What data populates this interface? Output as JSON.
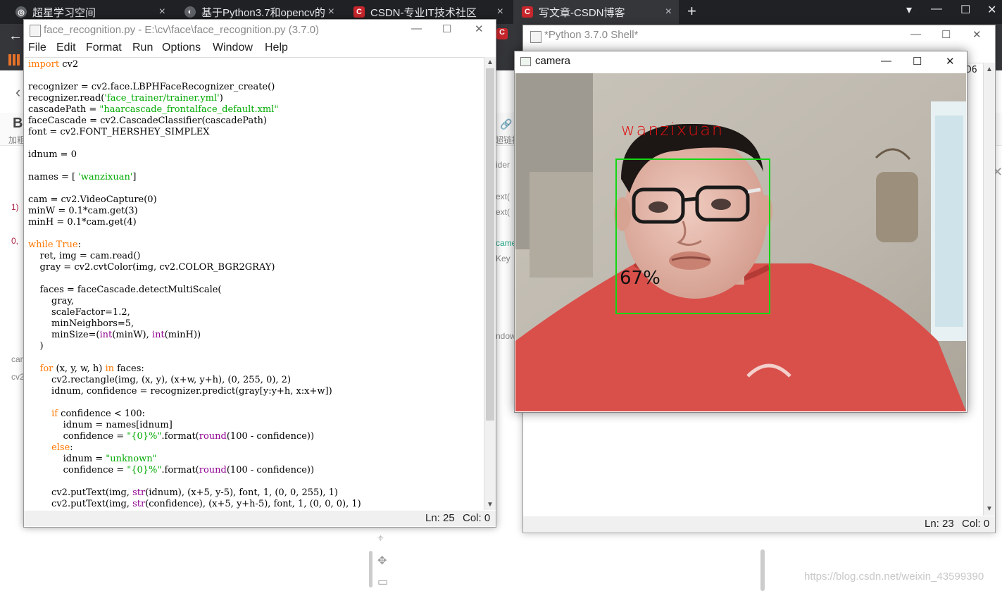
{
  "browser": {
    "tabs": [
      {
        "label": "超星学习空间",
        "icon": "globe-icon"
      },
      {
        "label": "基于Python3.7和opencv的",
        "icon": "github-icon"
      },
      {
        "label": "CSDN-专业IT技术社区",
        "icon": "csdn-icon"
      },
      {
        "label": "写文章-CSDN博客",
        "icon": "csdn-icon"
      }
    ],
    "tab_close_glyph": "×",
    "new_tab_glyph": "+",
    "bookmark_glyph": "C",
    "link_label": "超链接",
    "bold_label": "加粗",
    "bg_fragments": [
      "ider",
      "ext(",
      "ext(",
      "came",
      "Key",
      "ndow",
      "1)",
      "0,",
      "cam",
      "cv2"
    ]
  },
  "idle_editor": {
    "title": "face_recognition.py - E:\\cv\\face\\face_recognition.py (3.7.0)",
    "menu": [
      "File",
      "Edit",
      "Format",
      "Run",
      "Options",
      "Window",
      "Help"
    ],
    "status_line": "Ln: 25",
    "status_col": "Col: 0"
  },
  "shell": {
    "title": "*Python 3.7.0 Shell*",
    "partial_text": "D6",
    "status_line": "Ln: 23",
    "status_col": "Col: 0"
  },
  "camera": {
    "title": "camera",
    "detected_name": "wanzixuan",
    "confidence_label": "67%",
    "box_color": "#12d712",
    "name_color": "#e01010"
  },
  "window_controls": {
    "minimize": "—",
    "maximize": "☐",
    "close": "✕"
  },
  "watermark": "https://blog.csdn.net/weixin_43599390"
}
